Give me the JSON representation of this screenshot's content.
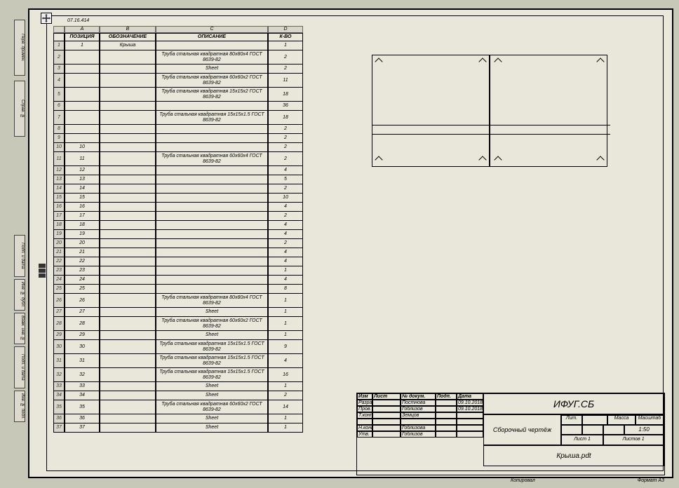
{
  "filename_label": "07.16.414",
  "columns": {
    "A": "A",
    "B": "B",
    "C": "C",
    "D": "D"
  },
  "header": {
    "pos": "ПОЗИЦИЯ",
    "desig": "ОБОЗНАЧЕНИЕ",
    "descr": "ОПИСАНИЕ",
    "qty": "К-ВО"
  },
  "rows": [
    {
      "n": "1",
      "pos": "1",
      "desig": "Крыша",
      "descr": "",
      "qty": "1"
    },
    {
      "n": "2",
      "pos": "",
      "desig": "",
      "descr": "Труба стальная квадратная 80х80х4 ГОСТ 8639-82",
      "qty": "2",
      "tall": true
    },
    {
      "n": "3",
      "pos": "",
      "desig": "",
      "descr": "Sheet",
      "qty": "2"
    },
    {
      "n": "4",
      "pos": "",
      "desig": "",
      "descr": "Труба стальная квадратная 60х60х2 ГОСТ 8639-82",
      "qty": "11",
      "tall": true
    },
    {
      "n": "5",
      "pos": "",
      "desig": "",
      "descr": "Труба стальная квадратная 15х15х2 ГОСТ 8639-82",
      "qty": "18",
      "tall": true
    },
    {
      "n": "6",
      "pos": "",
      "desig": "",
      "descr": "",
      "qty": "36"
    },
    {
      "n": "7",
      "pos": "",
      "desig": "",
      "descr": "Труба стальная квадратная 15х15х1.5 ГОСТ 8639-82",
      "qty": "18",
      "tall": true
    },
    {
      "n": "8",
      "pos": "",
      "desig": "",
      "descr": "",
      "qty": "2"
    },
    {
      "n": "9",
      "pos": "",
      "desig": "",
      "descr": "",
      "qty": "2"
    },
    {
      "n": "10",
      "pos": "10",
      "desig": "",
      "descr": "",
      "qty": "2"
    },
    {
      "n": "11",
      "pos": "11",
      "desig": "",
      "descr": "Труба стальная квадратная 60х60х4 ГОСТ 8639-82",
      "qty": "2",
      "tall": true
    },
    {
      "n": "12",
      "pos": "12",
      "desig": "",
      "descr": "",
      "qty": "4"
    },
    {
      "n": "13",
      "pos": "13",
      "desig": "",
      "descr": "",
      "qty": "5"
    },
    {
      "n": "14",
      "pos": "14",
      "desig": "",
      "descr": "",
      "qty": "2"
    },
    {
      "n": "15",
      "pos": "15",
      "desig": "",
      "descr": "",
      "qty": "10"
    },
    {
      "n": "16",
      "pos": "16",
      "desig": "",
      "descr": "",
      "qty": "4"
    },
    {
      "n": "17",
      "pos": "17",
      "desig": "",
      "descr": "",
      "qty": "2"
    },
    {
      "n": "18",
      "pos": "18",
      "desig": "",
      "descr": "",
      "qty": "4"
    },
    {
      "n": "19",
      "pos": "19",
      "desig": "",
      "descr": "",
      "qty": "4"
    },
    {
      "n": "20",
      "pos": "20",
      "desig": "",
      "descr": "",
      "qty": "2"
    },
    {
      "n": "21",
      "pos": "21",
      "desig": "",
      "descr": "",
      "qty": "4"
    },
    {
      "n": "22",
      "pos": "22",
      "desig": "",
      "descr": "",
      "qty": "4"
    },
    {
      "n": "23",
      "pos": "23",
      "desig": "",
      "descr": "",
      "qty": "1"
    },
    {
      "n": "24",
      "pos": "24",
      "desig": "",
      "descr": "",
      "qty": "4"
    },
    {
      "n": "25",
      "pos": "25",
      "desig": "",
      "descr": "",
      "qty": "8"
    },
    {
      "n": "26",
      "pos": "26",
      "desig": "",
      "descr": "Труба стальная квадратная 80х80х4 ГОСТ 8639-82",
      "qty": "1",
      "tall": true
    },
    {
      "n": "27",
      "pos": "27",
      "desig": "",
      "descr": "Sheet",
      "qty": "1"
    },
    {
      "n": "28",
      "pos": "28",
      "desig": "",
      "descr": "Труба стальная квадратная 60х60х2 ГОСТ 8639-82",
      "qty": "1",
      "tall": true
    },
    {
      "n": "29",
      "pos": "29",
      "desig": "",
      "descr": "Sheet",
      "qty": "1"
    },
    {
      "n": "30",
      "pos": "30",
      "desig": "",
      "descr": "Труба стальная квадратная 15х15х1.5 ГОСТ 8639-82",
      "qty": "9",
      "tall": true
    },
    {
      "n": "31",
      "pos": "31",
      "desig": "",
      "descr": "Труба стальная квадратная 15х15х1.5 ГОСТ 8639-82",
      "qty": "4",
      "tall": true
    },
    {
      "n": "32",
      "pos": "32",
      "desig": "",
      "descr": "Труба стальная квадратная 15х15х1.5 ГОСТ 8639-82",
      "qty": "16",
      "tall": true
    },
    {
      "n": "33",
      "pos": "33",
      "desig": "",
      "descr": "Sheet",
      "qty": "1"
    },
    {
      "n": "34",
      "pos": "34",
      "desig": "",
      "descr": "Sheet",
      "qty": "2"
    },
    {
      "n": "35",
      "pos": "35",
      "desig": "",
      "descr": "Труба стальная квадратная 60х60х2 ГОСТ 8639-82",
      "qty": "14",
      "tall": true
    },
    {
      "n": "36",
      "pos": "36",
      "desig": "",
      "descr": "Sheet",
      "qty": "1"
    },
    {
      "n": "37",
      "pos": "37",
      "desig": "",
      "descr": "Sheet",
      "qty": "1"
    }
  ],
  "title_block": {
    "code": "ИФУГ.СБ",
    "drawing_type": "Сборочный чертёж",
    "part_name": "Крыша.pdt",
    "scale": "1:50",
    "sheet": "Лист 1",
    "sheets": "Листов 1",
    "format": "Формат A3",
    "kopirovat": "Копировал",
    "hdr": {
      "c1": "Изм",
      "c2": "Лист",
      "c3": "№ докум.",
      "c4": "Подп.",
      "c5": "Дата"
    },
    "rows": [
      {
        "c1": "Разраб.",
        "c2": "",
        "c3": "Постнова",
        "c4": "",
        "c5": "09.10.2018"
      },
      {
        "c1": "Пров.",
        "c2": "",
        "c3": "Гоблизов",
        "c4": "",
        "c5": "09.10.2018"
      },
      {
        "c1": "Т.контр.",
        "c2": "",
        "c3": "Земцов",
        "c4": "",
        "c5": ""
      },
      {
        "c1": "",
        "c2": "",
        "c3": "",
        "c4": "",
        "c5": ""
      },
      {
        "c1": "Н.контр.",
        "c2": "",
        "c3": "Гоблизова",
        "c4": "",
        "c5": ""
      },
      {
        "c1": "Утв.",
        "c2": "",
        "c3": "Гоблизов",
        "c4": "",
        "c5": ""
      }
    ],
    "stamp": {
      "lit": "Лит.",
      "massa": "Масса",
      "masht": "Масштаб"
    }
  },
  "side_labels": [
    "Перв. примен.",
    "Справ. №",
    "",
    "Подп. и дата",
    "Инв. № дубл.",
    "Взам. инв. №",
    "Подп. и дата",
    "Инв. № подл."
  ]
}
